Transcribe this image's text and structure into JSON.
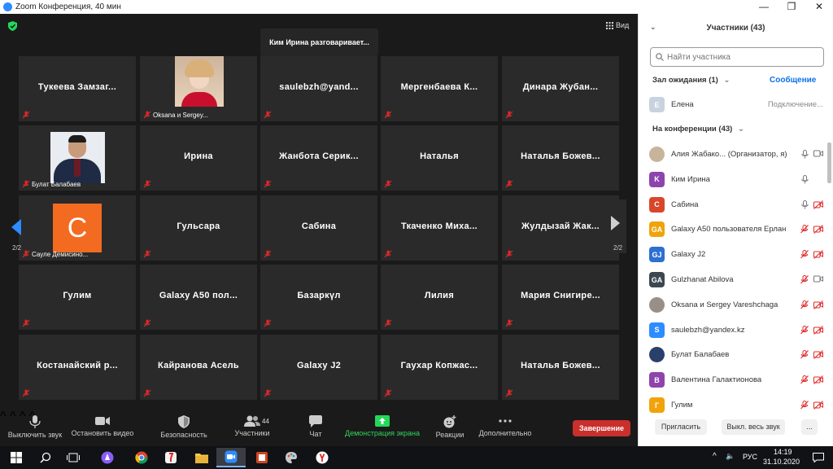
{
  "window": {
    "title": "Zoom Конференция, 40 мин",
    "min": "—",
    "max": "❐",
    "close": "✕"
  },
  "meeting": {
    "speaker_text": "Ким Ирина разговаривает...",
    "view_label": "Вид",
    "page_left": "2/2",
    "page_right": "2/2",
    "tiles": [
      {
        "name": "Тукеева Замзаг..."
      },
      {
        "name": "",
        "small": "Oksana и Sergey..."
      },
      {
        "name": "saulebzh@yand..."
      },
      {
        "name": "Мергенбаева К..."
      },
      {
        "name": "Динара Жубан..."
      },
      {
        "name": "",
        "small": "Булат Балабаев"
      },
      {
        "name": "Ирина"
      },
      {
        "name": "Жанбота Серик..."
      },
      {
        "name": "Наталья"
      },
      {
        "name": "Наталья Божев..."
      },
      {
        "name": "",
        "small": "Сауле Демисино...",
        "avatar_letter": "С"
      },
      {
        "name": "Гульсара"
      },
      {
        "name": "Сабина"
      },
      {
        "name": "Ткаченко Миха..."
      },
      {
        "name": "Жулдызай Жак..."
      },
      {
        "name": "Гулим"
      },
      {
        "name": "Galaxy A50 пол..."
      },
      {
        "name": "Базаркүл"
      },
      {
        "name": "Лилия"
      },
      {
        "name": "Мария Снигире..."
      },
      {
        "name": "Костанайский р..."
      },
      {
        "name": "Кайранова Асель"
      },
      {
        "name": "Galaxy J2"
      },
      {
        "name": "Гаухар Копжас..."
      },
      {
        "name": "Наталья Божев..."
      }
    ]
  },
  "toolbar": {
    "mute": "Выключить звук",
    "video": "Остановить видео",
    "security": "Безопасность",
    "participants": "Участники",
    "participants_count": "44",
    "chat": "Чат",
    "share": "Демонстрация экрана",
    "reactions": "Реакции",
    "more": "Дополнительно",
    "end": "Завершение"
  },
  "panel": {
    "title": "Участники (43)",
    "search_placeholder": "Найти участника",
    "waiting_label": "Зал ожидания (1)",
    "message_link": "Сообщение",
    "waiting_person": {
      "letter": "E",
      "name": "Елена",
      "status": "Подключение..."
    },
    "in_meeting_label": "На конференции (43)",
    "participants": [
      {
        "name": "Алия Жабако... (Организатор, я)",
        "letter": "",
        "color": "#c8b49a"
      },
      {
        "name": "Ким Ирина",
        "letter": "K",
        "color": "#8e44ad"
      },
      {
        "name": "Сабина",
        "letter": "C",
        "color": "#d9472b"
      },
      {
        "name": "Galaxy A50 пользователя Ерлан",
        "letter": "GA",
        "color": "#f0a30a"
      },
      {
        "name": "Galaxy J2",
        "letter": "GJ",
        "color": "#2d6fd2"
      },
      {
        "name": "Gulzhanat Abilova",
        "letter": "GA",
        "color": "#3c4750"
      },
      {
        "name": "Oksana и Sergey Vareshchaga",
        "letter": "",
        "color": "#9a8f86"
      },
      {
        "name": "saulebzh@yandex.kz",
        "letter": "S",
        "color": "#2d8cff"
      },
      {
        "name": "Булат Балабаев",
        "letter": "",
        "color": "#2b3f6b"
      },
      {
        "name": "Валентина Галактионова",
        "letter": "B",
        "color": "#8e44ad"
      },
      {
        "name": "Гулим",
        "letter": "Г",
        "color": "#f0a30a"
      }
    ],
    "invite": "Пригласить",
    "mute_all": "Выкл. весь звук",
    "more": "..."
  },
  "taskbar": {
    "lang": "РУС",
    "time": "14:19",
    "date": "31.10.2020"
  }
}
